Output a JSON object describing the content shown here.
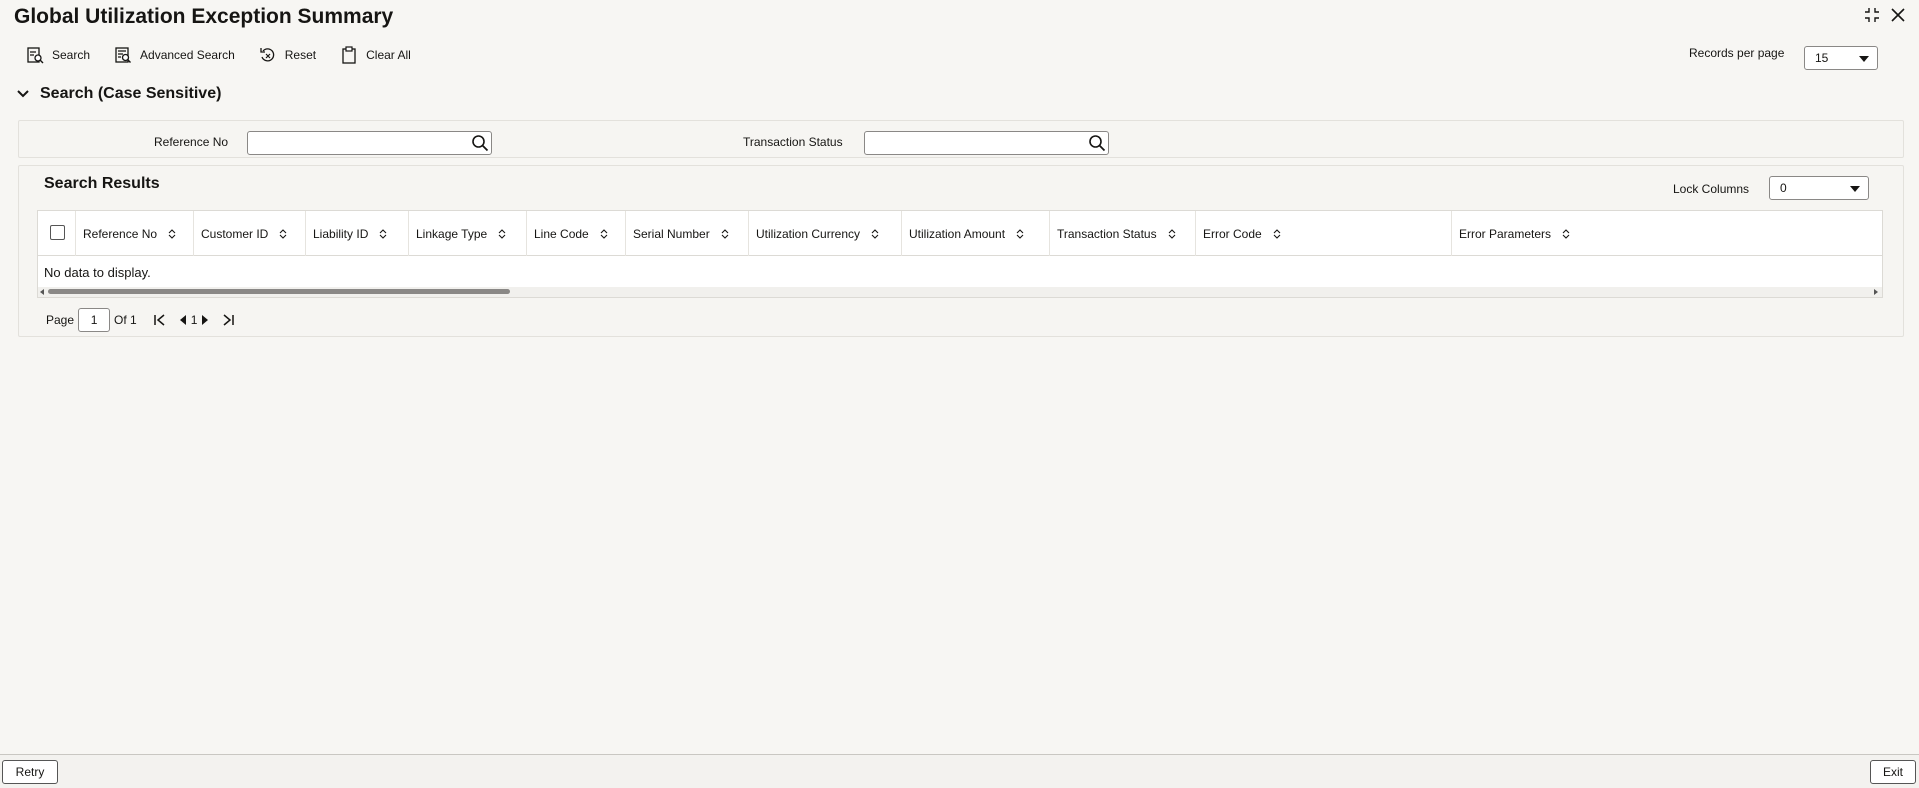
{
  "window": {
    "title": "Global Utilization Exception Summary",
    "controls": {
      "minimize_icon": "collapse-icon",
      "close_icon": "close-icon"
    }
  },
  "toolbar": {
    "search_label": "Search",
    "advanced_search_label": "Advanced Search",
    "reset_label": "Reset",
    "clear_all_label": "Clear All"
  },
  "records_per_page": {
    "label": "Records per page",
    "value": "15"
  },
  "search_section": {
    "title": "Search (Case Sensitive)",
    "fields": {
      "reference_no": {
        "label": "Reference No",
        "value": ""
      },
      "transaction_status": {
        "label": "Transaction Status",
        "value": ""
      }
    }
  },
  "results": {
    "title": "Search Results",
    "lock_columns": {
      "label": "Lock Columns",
      "value": "0"
    },
    "columns": [
      "Reference No",
      "Customer ID",
      "Liability ID",
      "Linkage Type",
      "Line Code",
      "Serial Number",
      "Utilization Currency",
      "Utilization Amount",
      "Transaction Status",
      "Error Code",
      "Error Parameters"
    ],
    "empty_message": "No data to display."
  },
  "pagination": {
    "page_label": "Page",
    "current_page": "1",
    "of_label": "Of 1",
    "page_number": "1"
  },
  "footer": {
    "retry_label": "Retry",
    "exit_label": "Exit"
  },
  "colors": {
    "background": "#f7f6f3",
    "panel": "#f6f5f2",
    "border": "#dcdad5",
    "text": "#161513"
  }
}
